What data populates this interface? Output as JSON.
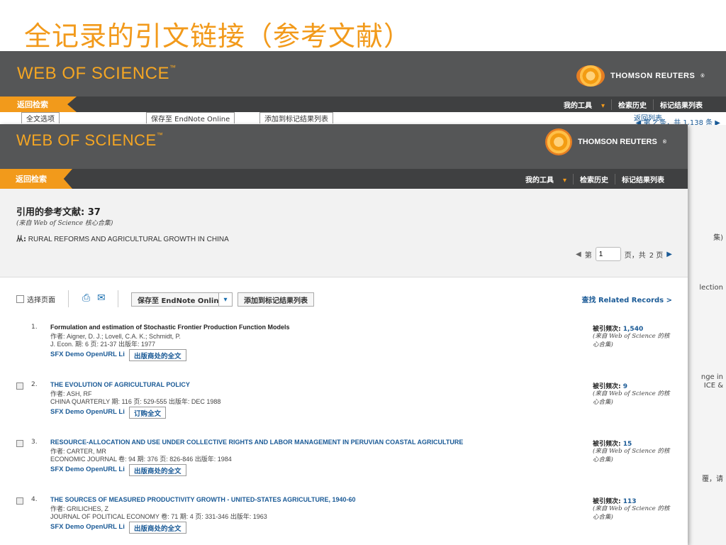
{
  "slide": {
    "title": "全记录的引文链接（参考文献）"
  },
  "colors": {
    "accent": "#f29a1b",
    "header_bg": "#555657",
    "nav_bg": "#3f4041",
    "link": "#1a5a96"
  },
  "brand": {
    "product": "WEB OF SCIENCE",
    "tm": "™",
    "company": "THOMSON REUTERS",
    "company_tm": "®"
  },
  "nav": {
    "back": "返回检索",
    "my_tools": "我的工具",
    "history": "检索历史",
    "marked_list": "标记结果列表"
  },
  "back_screen": {
    "toolbar_save": "保存至 EndNote Online",
    "toolbar_add": "添加到标记结果列表",
    "toolbar_left": "全文选项",
    "pager": "◀ 第 2 条，共 1,138 条 ▶",
    "return_list": "返回列表",
    "right_col": [
      "集)",
      "lection",
      "nge in",
      "ICE &",
      "覆，请"
    ]
  },
  "refs": {
    "heading": "引用的参考文献: 37",
    "source": "(来自 Web of Science 核心合集)",
    "from_label": "从:",
    "from_value": "RURAL REFORMS AND AGRICULTURAL GROWTH IN CHINA",
    "pager": {
      "page_label": "第",
      "page_value": "1",
      "of_label": "页，共",
      "total": "2 页"
    },
    "toolbar": {
      "select_page": "选择页面",
      "save": "保存至 EndNote Online",
      "add": "添加到标记结果列表",
      "related": "查找 Related Records >"
    },
    "records": [
      {
        "num": "1.",
        "title": "Formulation and estimation of Stochastic Frontier Production Function Models",
        "authors": "作者: Aigner, D. J.; Lovell, C.A. K.; Schmidt, P.",
        "source": "J. Econ.  期: 6   页: 21-37   出版年: 1977",
        "sfx": "SFX Demo OpenURL Li",
        "fulltext": "出版商处的全文",
        "cited_label": "被引频次:",
        "cited": "1,540",
        "cited_src": "(来自 Web of Science 的核心合集)"
      },
      {
        "num": "2.",
        "title": "THE EVOLUTION OF AGRICULTURAL POLICY",
        "authors": "作者: ASH, RF",
        "source": "CHINA QUARTERLY  期: 116   页: 529-555   出版年: DEC 1988",
        "sfx": "SFX Demo OpenURL Li",
        "fulltext": "订购全文",
        "cited_label": "被引频次:",
        "cited": "9",
        "cited_src": "(来自 Web of Science 的核心合集)"
      },
      {
        "num": "3.",
        "title": "RESOURCE-ALLOCATION AND USE UNDER COLLECTIVE RIGHTS AND LABOR MANAGEMENT IN PERUVIAN COASTAL AGRICULTURE",
        "authors": "作者: CARTER, MR",
        "source": "ECONOMIC JOURNAL  卷: 94   期: 376   页: 826-846   出版年: 1984",
        "sfx": "SFX Demo OpenURL Li",
        "fulltext": "出版商处的全文",
        "cited_label": "被引频次:",
        "cited": "15",
        "cited_src": "(来自 Web of Science 的核心合集)"
      },
      {
        "num": "4.",
        "title": "THE SOURCES OF MEASURED PRODUCTIVITY GROWTH - UNITED-STATES AGRICULTURE, 1940-60",
        "authors": "作者: GRILICHES, Z",
        "source": "JOURNAL OF POLITICAL ECONOMY  卷: 71   期: 4   页: 331-346   出版年: 1963",
        "sfx": "SFX Demo OpenURL Li",
        "fulltext": "出版商处的全文",
        "cited_label": "被引频次:",
        "cited": "113",
        "cited_src": "(来自 Web of Science 的核心合集)"
      }
    ]
  }
}
